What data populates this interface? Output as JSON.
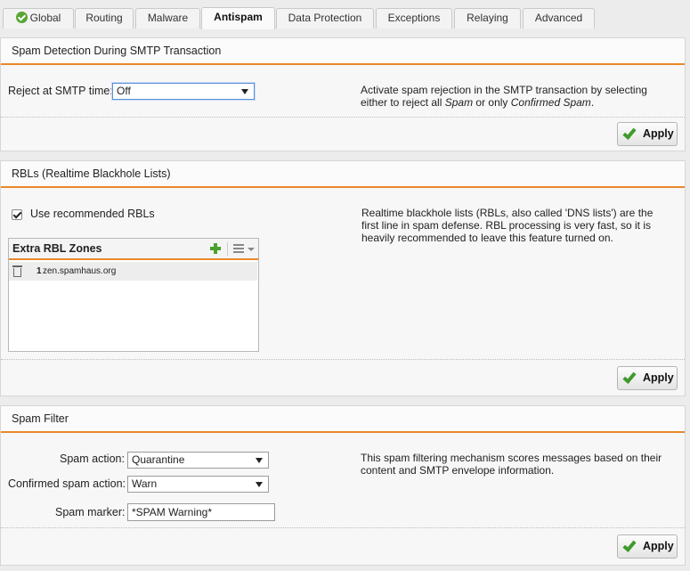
{
  "tabs": [
    {
      "label": "Global",
      "icon": "check-circle-icon",
      "active": false
    },
    {
      "label": "Routing",
      "active": false
    },
    {
      "label": "Malware",
      "active": false
    },
    {
      "label": "Antispam",
      "active": true
    },
    {
      "label": "Data Protection",
      "active": false
    },
    {
      "label": "Exceptions",
      "active": false
    },
    {
      "label": "Relaying",
      "active": false
    },
    {
      "label": "Advanced",
      "active": false
    }
  ],
  "smtp_section": {
    "title": "Spam Detection During SMTP Transaction",
    "reject_label": "Reject at SMTP time:",
    "reject_value": "Off",
    "desc_part1": "Activate spam rejection in the SMTP transaction by selecting either to reject all ",
    "desc_spam": "Spam",
    "desc_part2": " or only ",
    "desc_confirmed": "Confirmed Spam",
    "desc_part3": ".",
    "apply_label": "Apply"
  },
  "rbl_section": {
    "title": "RBLs (Realtime Blackhole Lists)",
    "use_recommended_label": "Use recommended RBLs",
    "use_recommended_checked": true,
    "description": "Realtime blackhole lists (RBLs, also called 'DNS lists') are the first line in spam defense. RBL processing is very fast, so it is heavily recommended to leave this feature turned on.",
    "extra_zones_title": "Extra RBL Zones",
    "zones": [
      {
        "num": "1",
        "value": "zen.spamhaus.org"
      }
    ],
    "apply_label": "Apply"
  },
  "filter_section": {
    "title": "Spam Filter",
    "spam_action_label": "Spam action:",
    "spam_action_value": "Quarantine",
    "confirmed_action_label": "Confirmed spam action:",
    "confirmed_action_value": "Warn",
    "marker_label": "Spam marker:",
    "marker_value": "*SPAM Warning*",
    "description": "This spam filtering mechanism scores messages based on their content and SMTP envelope information.",
    "apply_label": "Apply"
  },
  "colors": {
    "accent_orange": "#e8882a",
    "ok_green": "#4aa12e"
  }
}
